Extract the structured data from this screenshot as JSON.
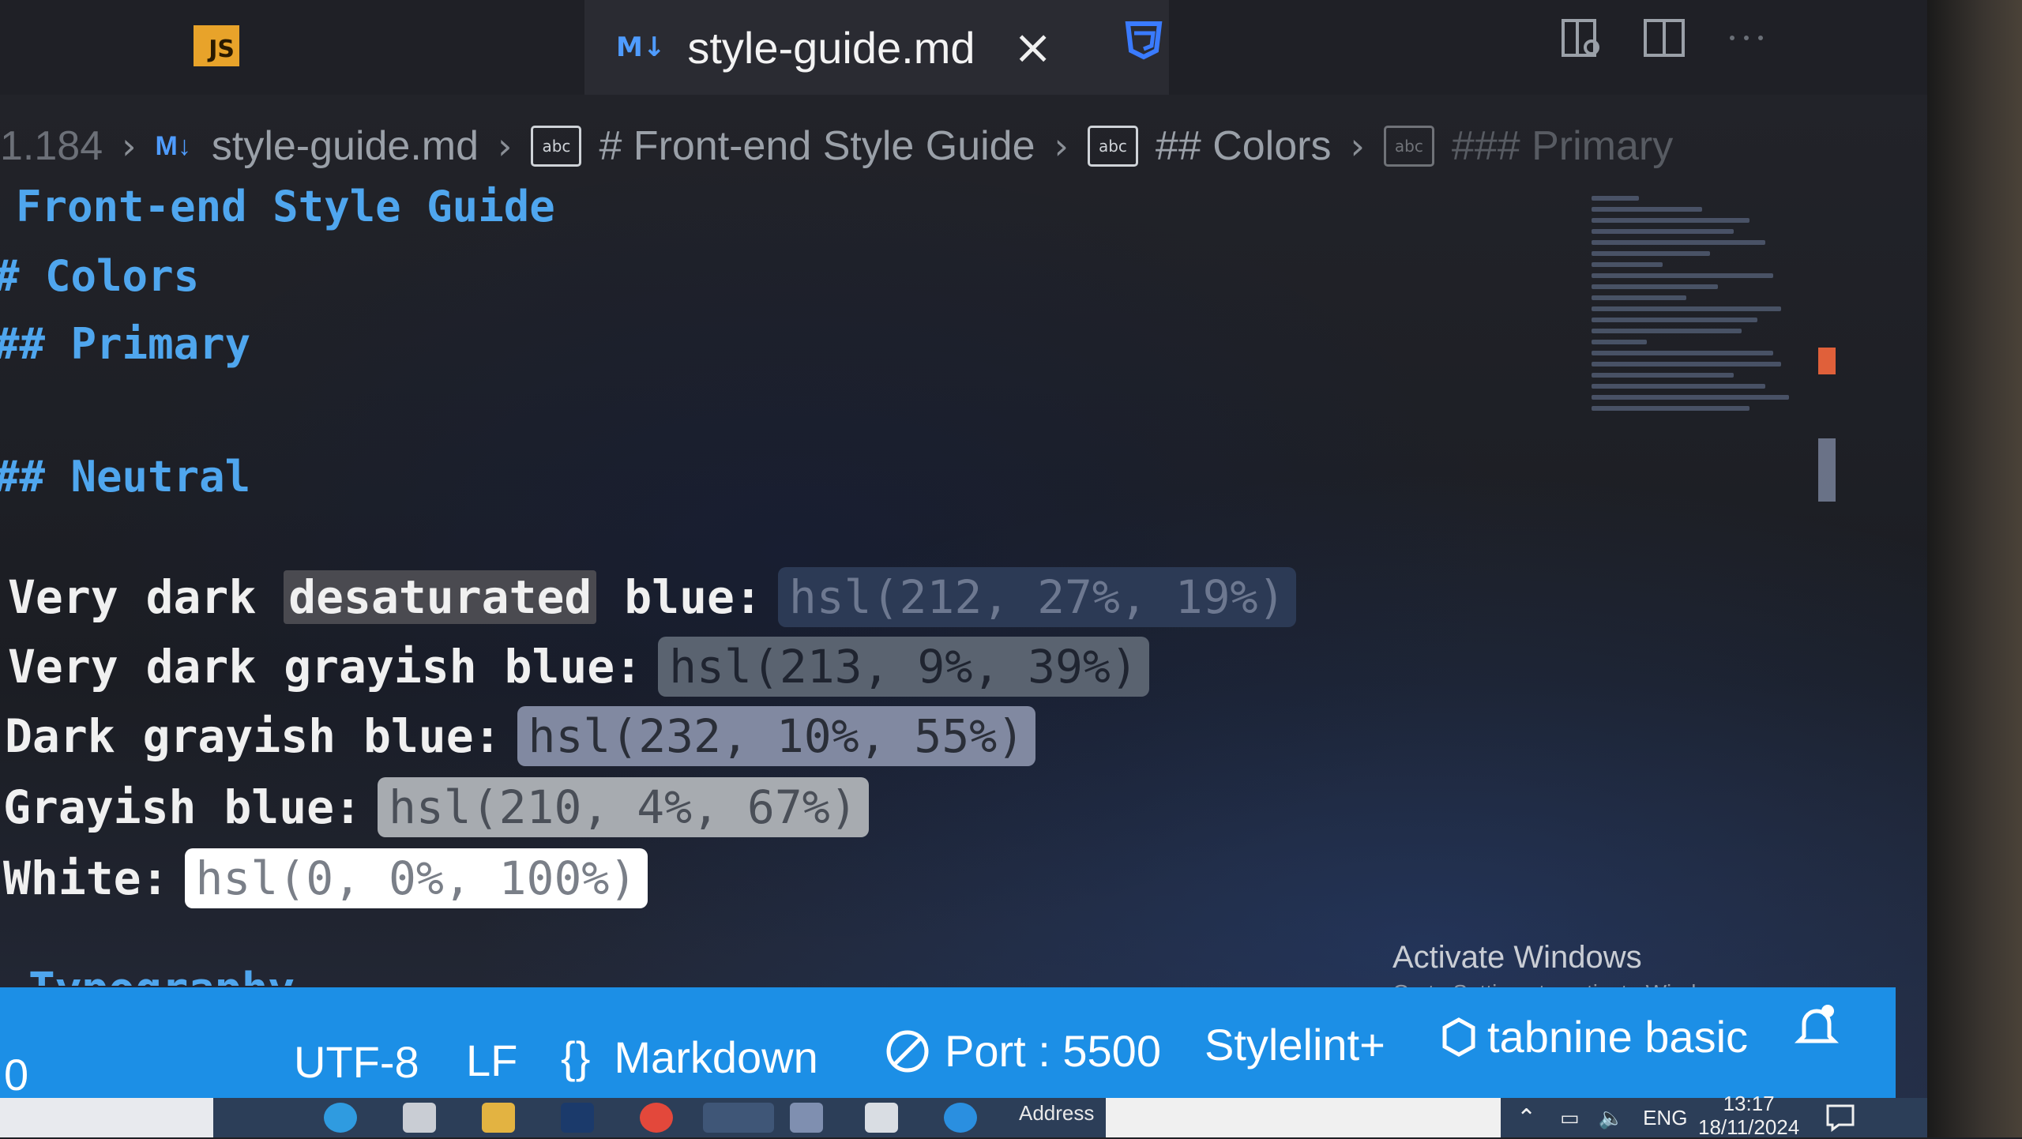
{
  "tabs": {
    "js_badge": "JS",
    "active": {
      "icon_label": "M↓",
      "title": "style-guide.md",
      "close": "×"
    }
  },
  "breadcrumb": {
    "prefix": "1.184",
    "md_icon": "M↓",
    "file": "style-guide.md",
    "abc": "abc",
    "h1": "# Front-end Style Guide",
    "h2": "## Colors",
    "h3": "### Primary"
  },
  "editor": {
    "title": "Front-end Style Guide",
    "colors": "# Colors",
    "primary": "## Primary",
    "neutral": "## Neutral",
    "rows": [
      {
        "label_pre": "Very dark ",
        "label_sel": "desaturated",
        "label_post": " blue:",
        "value": "hsl(212, 27%, 19%)",
        "bg": "#2c3a55"
      },
      {
        "label_pre": "Very dark grayish blue:",
        "label_sel": "",
        "label_post": "",
        "value": "hsl(213, 9%, 39%)",
        "bg": "#5a6370"
      },
      {
        "label_pre": "Dark grayish blue:",
        "label_sel": "",
        "label_post": "",
        "value": "hsl(232, 10%, 55%)",
        "bg": "#8189a1"
      },
      {
        "label_pre": "Grayish blue:",
        "label_sel": "",
        "label_post": "",
        "value": "hsl(210, 4%, 67%)",
        "bg": "#a7abb0"
      },
      {
        "label_pre": "White:",
        "label_sel": "",
        "label_post": "",
        "value": "hsl(0, 0%, 100%)",
        "bg": "#ffffff"
      }
    ],
    "next_heading": "Typography"
  },
  "watermark": {
    "title": "Activate Windows",
    "subtitle": "Go to Settings to activate Windows."
  },
  "statusbar": {
    "left": "0",
    "encoding": "UTF-8",
    "eol": "LF",
    "braces": "{}",
    "language": "Markdown",
    "port": "Port : 5500",
    "stylelint": "Stylelint+",
    "tabnine": "tabnine basic",
    "accent": "#1c8fe6"
  },
  "taskbar": {
    "address": "Address",
    "lang": "ENG",
    "time": "13:17",
    "date": "18/11/2024"
  }
}
